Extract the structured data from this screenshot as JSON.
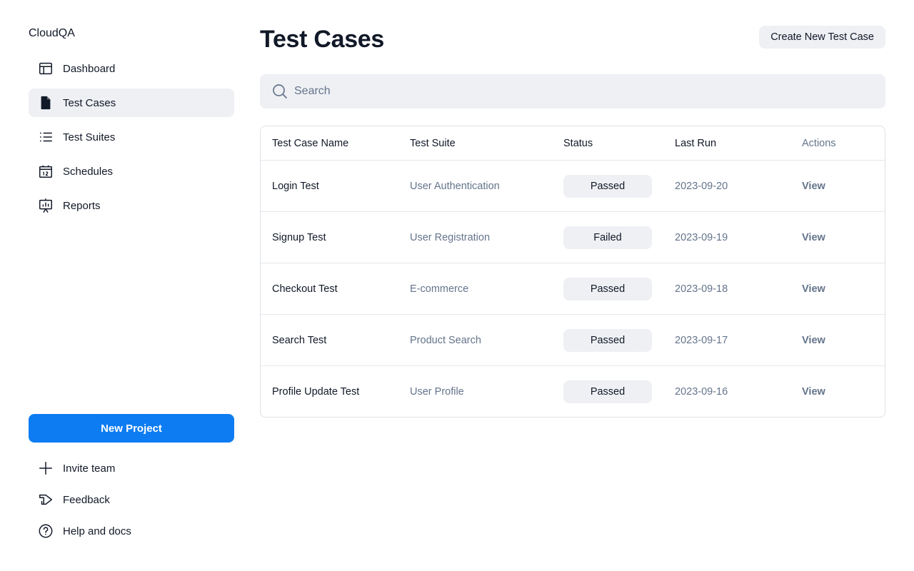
{
  "app": {
    "brand": "CloudQA"
  },
  "sidebar": {
    "items": [
      {
        "label": "Dashboard",
        "icon": "layout-icon",
        "active": false
      },
      {
        "label": "Test Cases",
        "icon": "file-icon",
        "active": true
      },
      {
        "label": "Test Suites",
        "icon": "list-icon",
        "active": false
      },
      {
        "label": "Schedules",
        "icon": "calendar-icon",
        "active": false
      },
      {
        "label": "Reports",
        "icon": "presentation-chart-icon",
        "active": false
      }
    ],
    "new_project_label": "New Project",
    "bottom_items": [
      {
        "label": "Invite team",
        "icon": "plus-icon"
      },
      {
        "label": "Feedback",
        "icon": "megaphone-icon"
      },
      {
        "label": "Help and docs",
        "icon": "help-circle-icon"
      }
    ]
  },
  "main": {
    "title": "Test Cases",
    "create_button_label": "Create New Test Case",
    "search": {
      "placeholder": "Search",
      "value": ""
    },
    "table": {
      "columns": [
        "Test Case Name",
        "Test Suite",
        "Status",
        "Last Run",
        "Actions"
      ],
      "rows": [
        {
          "name": "Login Test",
          "suite": "User Authentication",
          "status": "Passed",
          "last_run": "2023-09-20",
          "action": "View"
        },
        {
          "name": "Signup Test",
          "suite": "User Registration",
          "status": "Failed",
          "last_run": "2023-09-19",
          "action": "View"
        },
        {
          "name": "Checkout Test",
          "suite": "E-commerce",
          "status": "Passed",
          "last_run": "2023-09-18",
          "action": "View"
        },
        {
          "name": "Search Test",
          "suite": "Product Search",
          "status": "Passed",
          "last_run": "2023-09-17",
          "action": "View"
        },
        {
          "name": "Profile Update Test",
          "suite": "User Profile",
          "status": "Passed",
          "last_run": "2023-09-16",
          "action": "View"
        }
      ]
    }
  },
  "colors": {
    "primary": "#0d7cf2",
    "surface": "#eef0f4",
    "muted_text": "#64748b",
    "text": "#111827",
    "border": "#dde1e6"
  }
}
